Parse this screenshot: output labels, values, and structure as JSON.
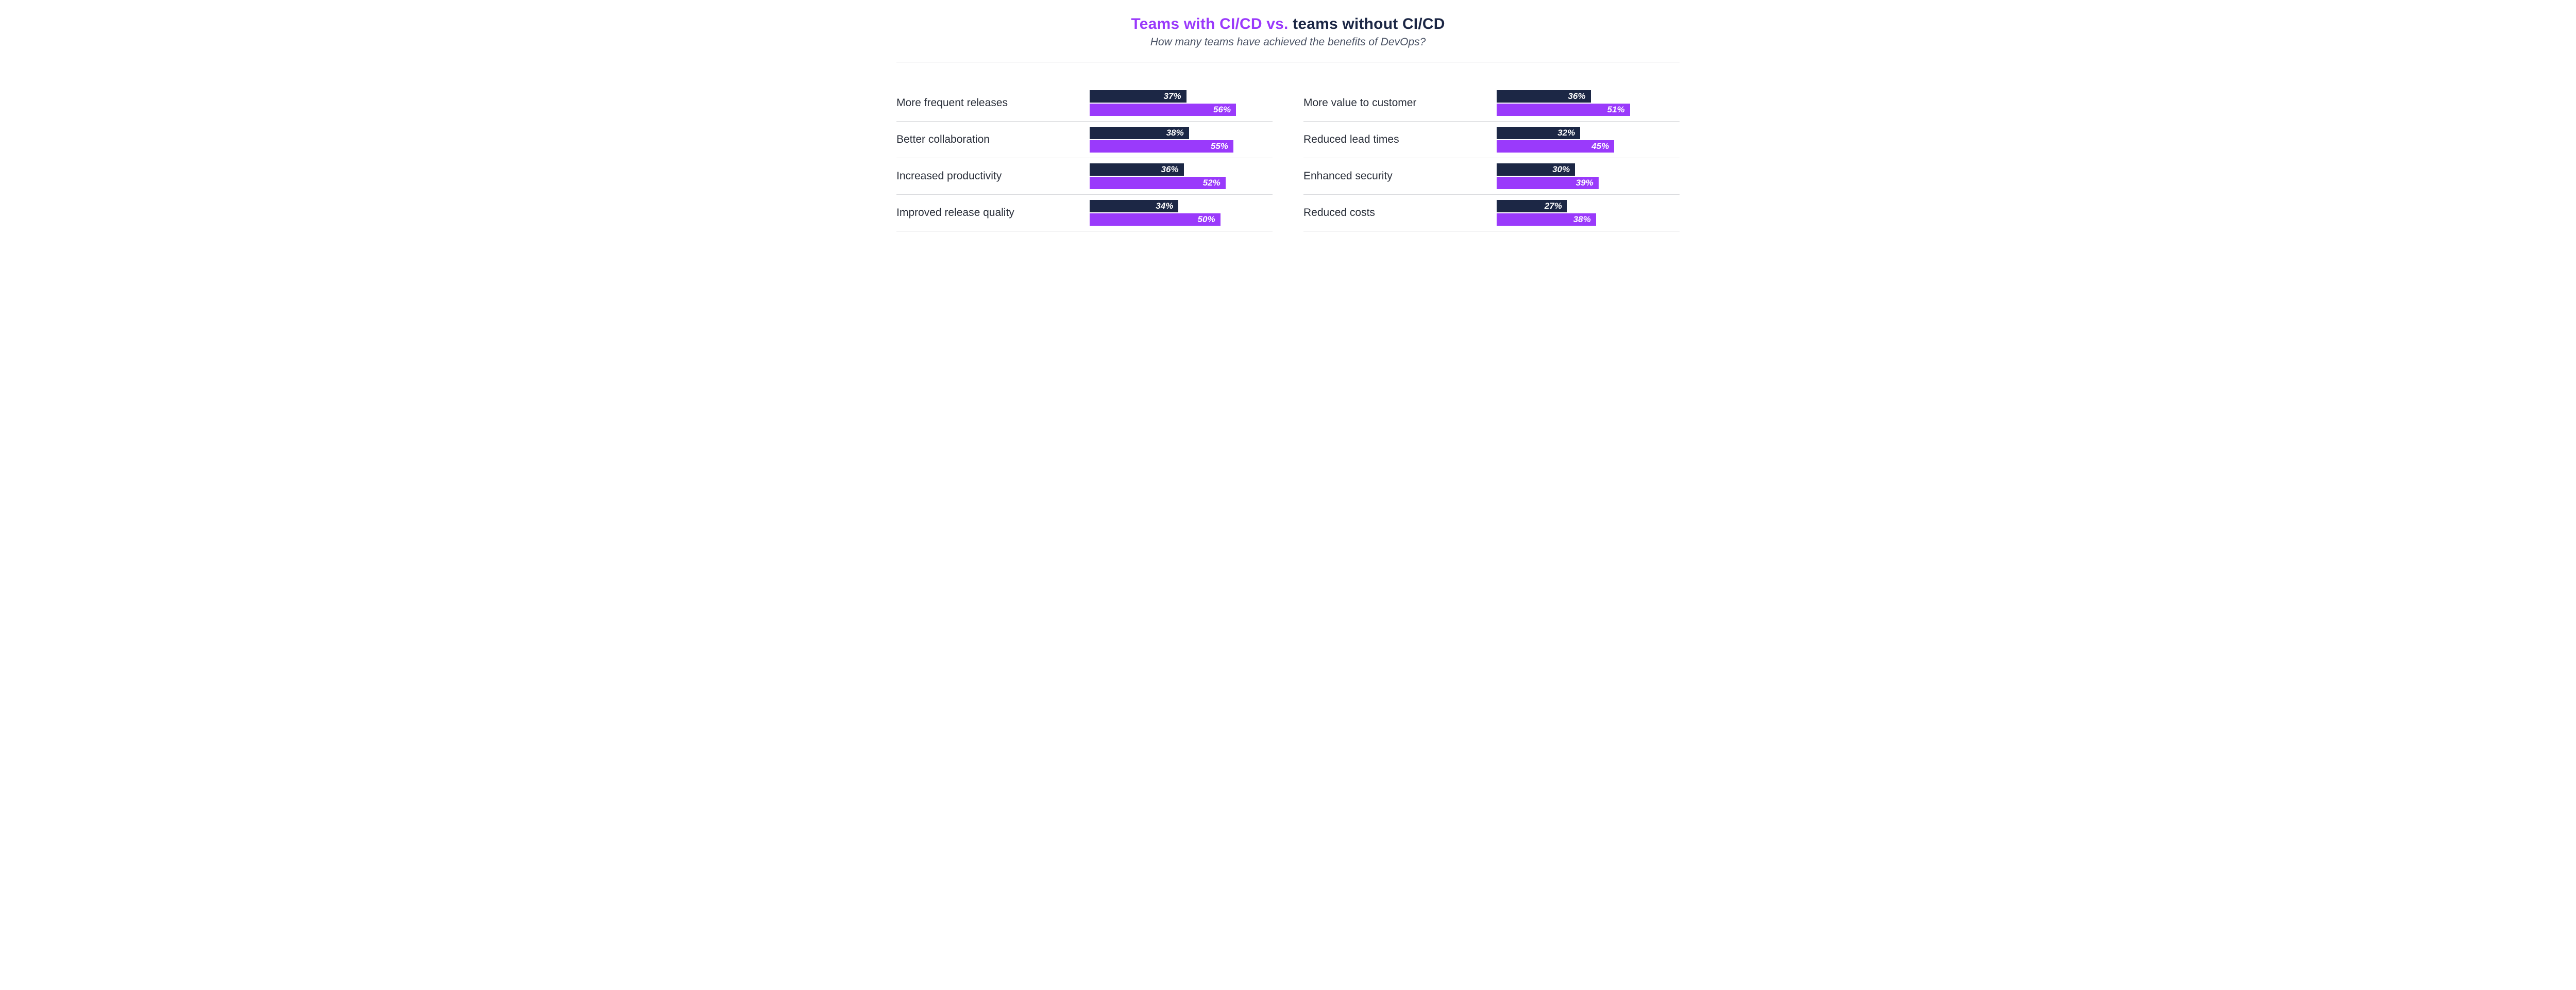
{
  "colors": {
    "accent": "#9a3afb",
    "dark": "#1c2745"
  },
  "title_a": "Teams with CI/CD vs. ",
  "title_b": "teams without CI/CD",
  "subtitle": "How many teams have achieved the benefits of DevOps?",
  "chart_data": {
    "type": "bar",
    "orientation": "horizontal",
    "grouped": true,
    "value_unit": "%",
    "xlim": [
      0,
      100
    ],
    "series_names": [
      "Teams without CI/CD",
      "Teams with CI/CD"
    ],
    "series_colors": [
      "#1c2745",
      "#9a3afb"
    ],
    "columns": [
      {
        "categories": [
          "More frequent releases",
          "Better collaboration",
          "Increased productivity",
          "Improved release quality"
        ],
        "series": [
          {
            "name": "Teams without CI/CD",
            "values": [
              37,
              38,
              36,
              34
            ]
          },
          {
            "name": "Teams with CI/CD",
            "values": [
              56,
              55,
              52,
              50
            ]
          }
        ]
      },
      {
        "categories": [
          "More value to customer",
          "Reduced lead times",
          "Enhanced security",
          "Reduced costs"
        ],
        "series": [
          {
            "name": "Teams without CI/CD",
            "values": [
              36,
              32,
              30,
              27
            ]
          },
          {
            "name": "Teams with CI/CD",
            "values": [
              51,
              45,
              39,
              38
            ]
          }
        ]
      }
    ]
  }
}
